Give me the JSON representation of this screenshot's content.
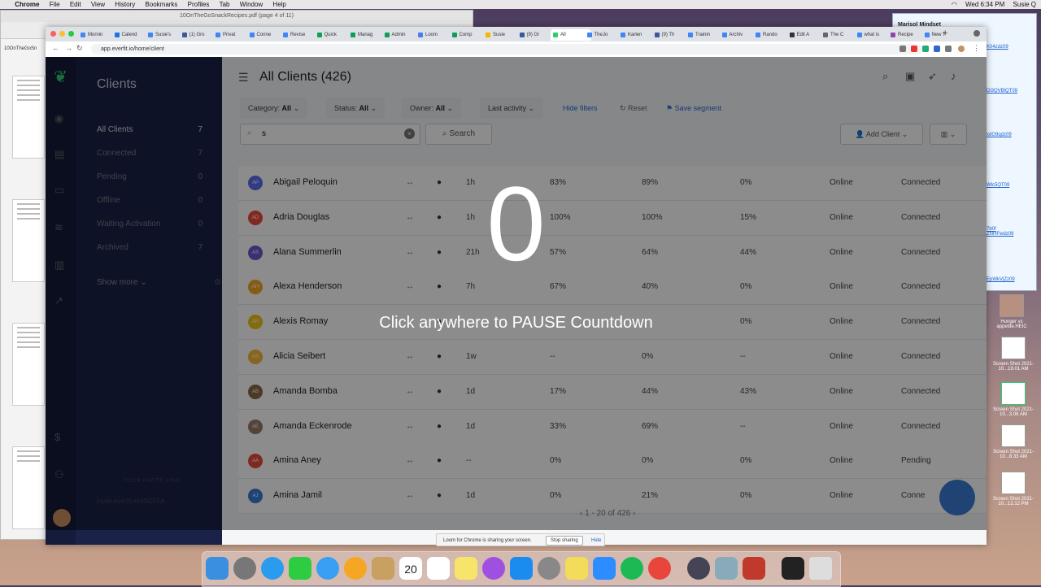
{
  "menubar": {
    "app": "Chrome",
    "items": [
      "File",
      "Edit",
      "View",
      "History",
      "Bookmarks",
      "Profiles",
      "Tab",
      "Window",
      "Help"
    ],
    "clock": "Wed 6:34 PM",
    "user": "Susie Q"
  },
  "pdf_window": {
    "title": "10OnTheGoSnackRecipes.pdf (page 4 of 11)",
    "sidebar_label": "10OnTheGoSn"
  },
  "notes_window": {
    "heading": "Marisol Mindset",
    "links": [
      "K04zdz09",
      "Dl3QVBlQT09",
      "xdG9qdz09",
      "Wlc5QT09",
      "7b0f\nZNHFwdz09",
      "EpWkVjZz09"
    ]
  },
  "desktop_icons": [
    {
      "label": "Hunger vs appetite.HEIC"
    },
    {
      "label": "Screen Shot 2021-10...19.01 AM"
    },
    {
      "label": "Screen Shot 2021-10...3.06 AM"
    },
    {
      "label": "Screen Shot 2021-10...8.33 AM"
    },
    {
      "label": "Screen Shot 2021-10...12.12 PM"
    }
  ],
  "browser": {
    "tabs": [
      "Mornin",
      "Calend",
      "Susie's",
      "(1) Gro",
      "Privat",
      "Conne",
      "Revise",
      "Quick",
      "Manag",
      "Admin",
      "Loom",
      "Comp",
      "Susie",
      "(9) Gr",
      "All",
      "TheJo",
      "Karlen",
      "(9) Th",
      "Trainin",
      "Archiv",
      "Rando",
      "Edit A",
      "The C",
      "what is",
      "Recipe",
      "New T"
    ],
    "active_tab_index": 14,
    "url": "app.everfit.io/home/client"
  },
  "sidebar": {
    "title": "Clients",
    "items": [
      {
        "label": "All Clients",
        "count": "7"
      },
      {
        "label": "Connected",
        "count": "7"
      },
      {
        "label": "Pending",
        "count": "0"
      },
      {
        "label": "Offline",
        "count": "0"
      },
      {
        "label": "Waiting Activation",
        "count": "0"
      },
      {
        "label": "Archived",
        "count": "7"
      }
    ],
    "show_more": "Show more",
    "invite_heading": "YOUR INVITE LINK",
    "invite_link": "invite.everfit.io/4SCF5A..."
  },
  "main": {
    "title": "All Clients (426)",
    "filters": {
      "category_label": "Category:",
      "category_value": "All",
      "status_label": "Status:",
      "status_value": "All",
      "owner_label": "Owner:",
      "owner_value": "All",
      "last_activity": "Last activity",
      "hide_filters": "Hide filters",
      "reset": "Reset",
      "save_segment": "Save segment"
    },
    "search_value": "s",
    "search_button": "Search",
    "add_client": "Add Client",
    "rows": [
      {
        "initials": "AP",
        "color": "#5b6cf0",
        "name": "Abigail Peloquin",
        "last": "1h",
        "c1": "83%",
        "c2": "89%",
        "c3": "0%",
        "online": "Online",
        "status": "Connected"
      },
      {
        "initials": "AD",
        "color": "#e94b3c",
        "name": "Adria Douglas",
        "last": "1h",
        "c1": "100%",
        "c2": "100%",
        "c3": "15%",
        "online": "Online",
        "status": "Connected"
      },
      {
        "initials": "AS",
        "color": "#6a5acd",
        "name": "Alana Summerlin",
        "last": "21h",
        "c1": "57%",
        "c2": "64%",
        "c3": "44%",
        "online": "Online",
        "status": "Connected"
      },
      {
        "initials": "AH",
        "color": "#f5a623",
        "name": "Alexa Henderson",
        "last": "7h",
        "c1": "67%",
        "c2": "40%",
        "c3": "0%",
        "online": "Online",
        "status": "Connected"
      },
      {
        "initials": "AR",
        "color": "#f0c419",
        "name": "Alexis Romay",
        "last": "",
        "c1": "",
        "c2": "",
        "c3": "0%",
        "online": "Online",
        "status": "Connected"
      },
      {
        "initials": "AS",
        "color": "#f7b733",
        "name": "Alicia Seibert",
        "last": "1w",
        "c1": "--",
        "c2": "0%",
        "c3": "--",
        "online": "Online",
        "status": "Connected"
      },
      {
        "initials": "AB",
        "color": "#8a6a4a",
        "name": "Amanda Bomba",
        "last": "1d",
        "c1": "17%",
        "c2": "44%",
        "c3": "43%",
        "online": "Online",
        "status": "Connected"
      },
      {
        "initials": "AE",
        "color": "#9a7a6a",
        "name": "Amanda Eckenrode",
        "last": "1d",
        "c1": "33%",
        "c2": "69%",
        "c3": "--",
        "online": "Online",
        "status": "Connected"
      },
      {
        "initials": "AA",
        "color": "#e94b3c",
        "name": "Amina Aney",
        "last": "--",
        "c1": "0%",
        "c2": "0%",
        "c3": "0%",
        "online": "Online",
        "status": "Pending"
      },
      {
        "initials": "AJ",
        "color": "#3a7bd5",
        "name": "Amina Jamil",
        "last": "1d",
        "c1": "0%",
        "c2": "21%",
        "c3": "0%",
        "online": "Online",
        "status": "Conne"
      }
    ],
    "pagination": "1 - 20 of 426"
  },
  "overlay": {
    "count": "0",
    "message": "Click anywhere to PAUSE Countdown"
  },
  "loom": {
    "message": "Loom for Chrome is sharing your screen.",
    "stop": "Stop sharing",
    "hide": "Hide"
  },
  "dock": {
    "calendar_day": "20"
  }
}
